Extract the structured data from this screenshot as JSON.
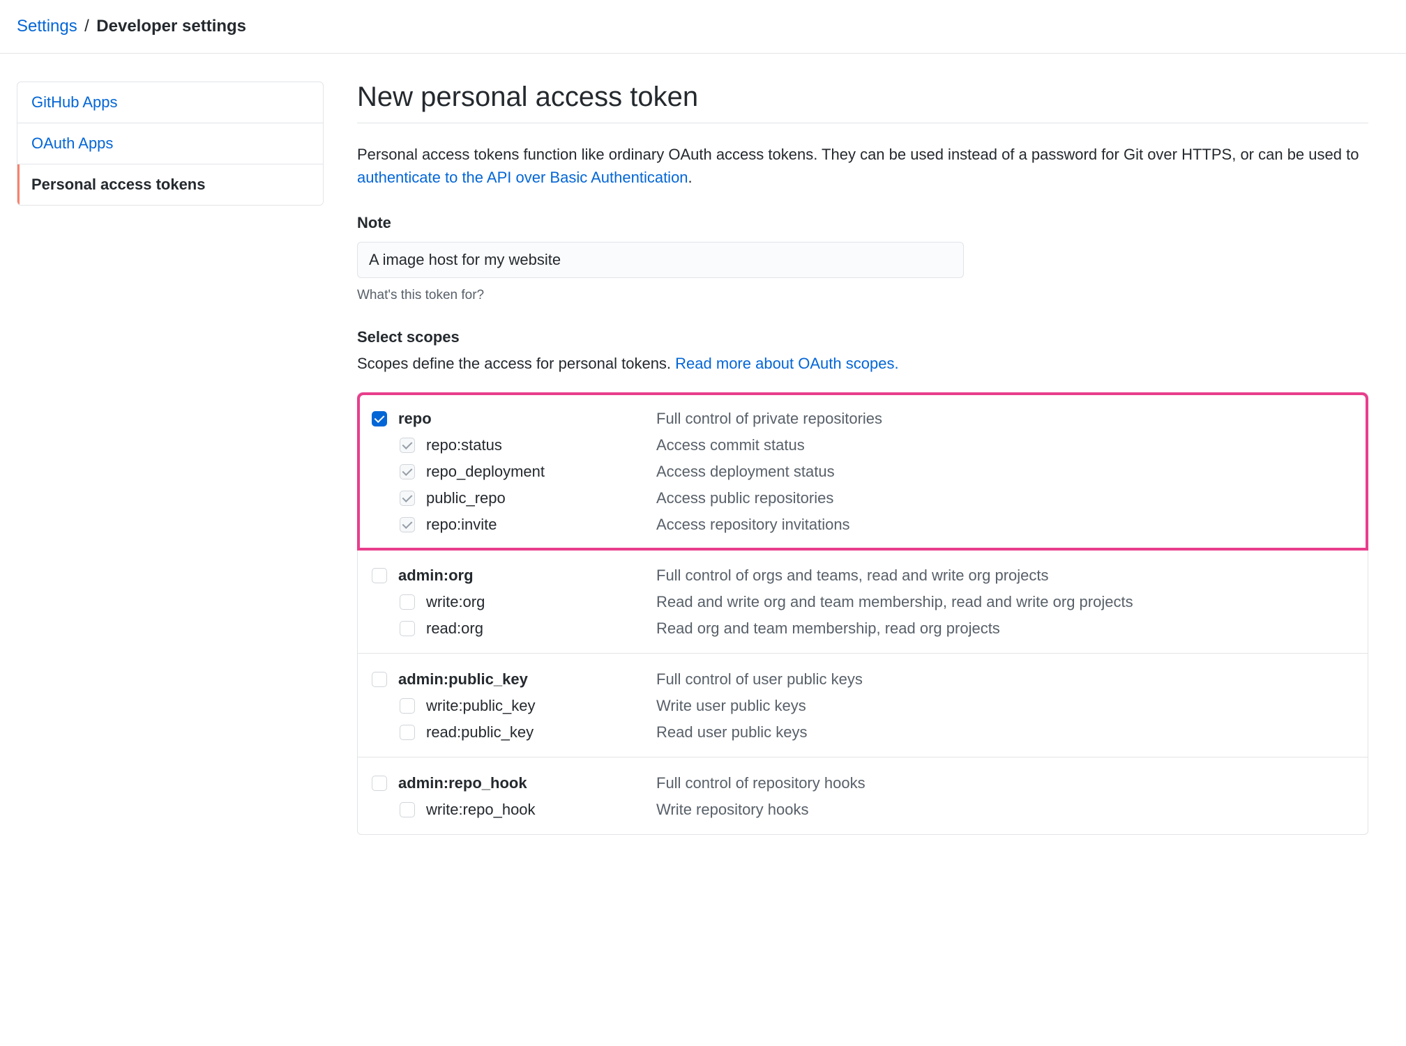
{
  "breadcrumb": {
    "parent": "Settings",
    "current": "Developer settings"
  },
  "sidebar": {
    "items": [
      {
        "label": "GitHub Apps",
        "selected": false
      },
      {
        "label": "OAuth Apps",
        "selected": false
      },
      {
        "label": "Personal access tokens",
        "selected": true
      }
    ]
  },
  "page": {
    "title": "New personal access token",
    "intro_before": "Personal access tokens function like ordinary OAuth access tokens. They can be used instead of a password for Git over HTTPS, or can be used to ",
    "intro_link": "authenticate to the API over Basic Authentication",
    "intro_after": "."
  },
  "form": {
    "note_label": "Note",
    "note_value": "A image host for my website",
    "note_hint": "What's this token for?",
    "scopes_heading": "Select scopes",
    "scopes_intro_before": "Scopes define the access for personal tokens. ",
    "scopes_intro_link": "Read more about OAuth scopes.",
    "scope_groups": [
      {
        "highlight": true,
        "parent": {
          "name": "repo",
          "desc": "Full control of private repositories",
          "checked": true,
          "disabled": false
        },
        "children": [
          {
            "name": "repo:status",
            "desc": "Access commit status",
            "checked": true,
            "disabled": true
          },
          {
            "name": "repo_deployment",
            "desc": "Access deployment status",
            "checked": true,
            "disabled": true
          },
          {
            "name": "public_repo",
            "desc": "Access public repositories",
            "checked": true,
            "disabled": true
          },
          {
            "name": "repo:invite",
            "desc": "Access repository invitations",
            "checked": true,
            "disabled": true
          }
        ]
      },
      {
        "highlight": false,
        "parent": {
          "name": "admin:org",
          "desc": "Full control of orgs and teams, read and write org projects",
          "checked": false,
          "disabled": false
        },
        "children": [
          {
            "name": "write:org",
            "desc": "Read and write org and team membership, read and write org projects",
            "checked": false,
            "disabled": false
          },
          {
            "name": "read:org",
            "desc": "Read org and team membership, read org projects",
            "checked": false,
            "disabled": false
          }
        ]
      },
      {
        "highlight": false,
        "parent": {
          "name": "admin:public_key",
          "desc": "Full control of user public keys",
          "checked": false,
          "disabled": false
        },
        "children": [
          {
            "name": "write:public_key",
            "desc": "Write user public keys",
            "checked": false,
            "disabled": false
          },
          {
            "name": "read:public_key",
            "desc": "Read user public keys",
            "checked": false,
            "disabled": false
          }
        ]
      },
      {
        "highlight": false,
        "parent": {
          "name": "admin:repo_hook",
          "desc": "Full control of repository hooks",
          "checked": false,
          "disabled": false
        },
        "children": [
          {
            "name": "write:repo_hook",
            "desc": "Write repository hooks",
            "checked": false,
            "disabled": false
          }
        ]
      }
    ]
  }
}
